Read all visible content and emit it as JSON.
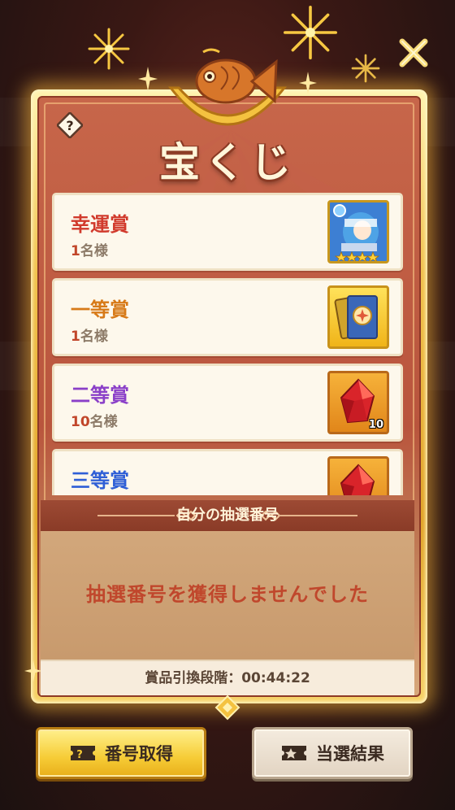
{
  "lottery": {
    "title": "宝くじ",
    "help_icon": "question-mark-icon",
    "close_icon": "close-x-icon"
  },
  "prizes": [
    {
      "name": "幸運賞",
      "count_num": "1",
      "count_unit": "名様",
      "color": "#d13a2c",
      "reward": "hero-card",
      "stars": 4
    },
    {
      "name": "一等賞",
      "count_num": "1",
      "count_unit": "名様",
      "color": "#d77a18",
      "reward": "item-card"
    },
    {
      "name": "二等賞",
      "count_num": "10",
      "count_unit": "名様",
      "color": "#8a3fc8",
      "reward": "red-crystal",
      "qty": "10"
    },
    {
      "name": "三等賞",
      "count_num": "",
      "count_unit": "",
      "color": "#2f5fd6",
      "reward": "red-crystal"
    }
  ],
  "my_numbers": {
    "title": "自分の抽選番号",
    "empty_message": "抽選番号を獲得しませんでした",
    "phase_label": "賞品引換段階：",
    "countdown": "00:44:22"
  },
  "buttons": {
    "get_number": "番号取得",
    "results": "当選結果"
  }
}
